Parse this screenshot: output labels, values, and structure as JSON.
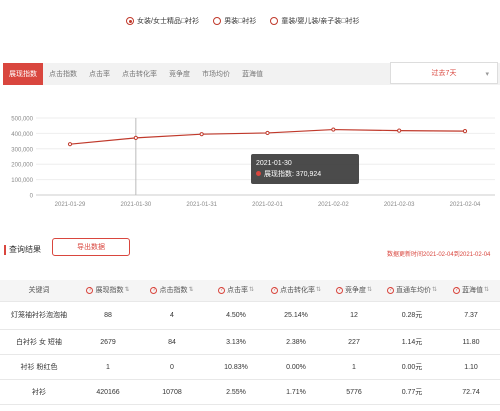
{
  "categories": [
    {
      "label": "女装/女士精品□衬衫",
      "selected": true
    },
    {
      "label": "男装□衬衫",
      "selected": false
    },
    {
      "label": "童装/婴儿装/亲子装□衬衫",
      "selected": false
    }
  ],
  "tabs": [
    "展现指数",
    "点击指数",
    "点击率",
    "点击转化率",
    "竞争度",
    "市场均价",
    "蓝海值"
  ],
  "active_tab": 0,
  "period": {
    "label": "过去7天",
    "caret": "▾"
  },
  "chart_data": {
    "type": "line",
    "x": [
      "2021-01-29",
      "2021-01-30",
      "2021-01-31",
      "2021-02-01",
      "2021-02-02",
      "2021-02-03",
      "2021-02-04"
    ],
    "series": [
      {
        "values": [
          330000,
          370924,
          395000,
          403000,
          425000,
          418000,
          415000
        ]
      }
    ],
    "ylim": [
      0,
      500000
    ],
    "yticks": [
      "500,000",
      "400,000",
      "300,000",
      "200,000",
      "100,000",
      "0"
    ],
    "grid": true,
    "color": "#c0392b"
  },
  "tooltip": {
    "date": "2021-01-30",
    "text": "展现指数: 370,924"
  },
  "result": {
    "title": "查询结果",
    "export_label": "导出数据",
    "update_text": "数据更新时间2021-02-04到2021-02-04"
  },
  "table": {
    "columns": [
      "关键词",
      "展现指数",
      "点击指数",
      "点击率",
      "点击转化率",
      "竞争度",
      "直通车均价",
      "蓝海值"
    ],
    "rows": [
      [
        "灯笼袖衬衫泡泡袖",
        "88",
        "4",
        "4.50%",
        "25.14%",
        "12",
        "0.28元",
        "7.37"
      ],
      [
        "白衬衫 女 短袖",
        "2679",
        "84",
        "3.13%",
        "2.38%",
        "227",
        "1.14元",
        "11.80"
      ],
      [
        "衬衫 粉红色",
        "1",
        "0",
        "10.83%",
        "0.00%",
        "1",
        "0.00元",
        "1.10"
      ],
      [
        "衬衫",
        "420166",
        "10708",
        "2.55%",
        "1.71%",
        "5776",
        "0.77元",
        "72.74"
      ]
    ]
  }
}
